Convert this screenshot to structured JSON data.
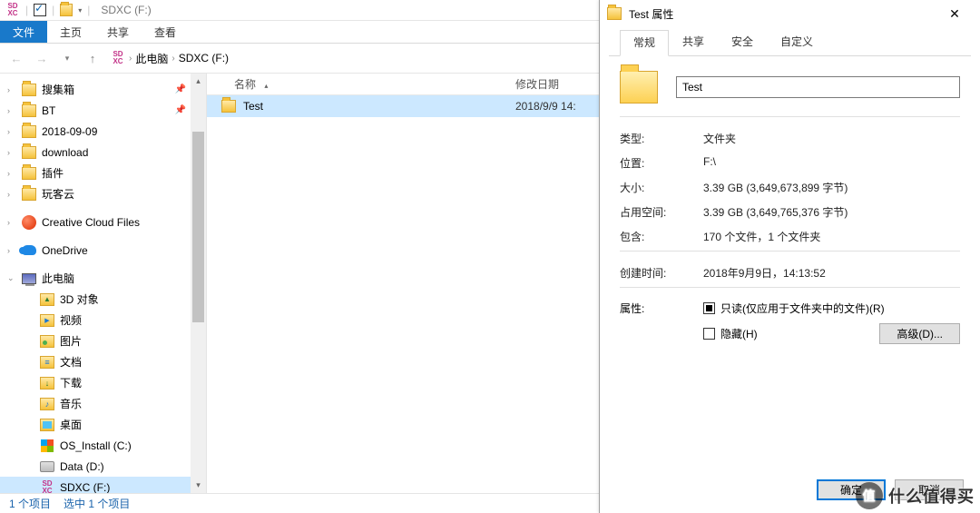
{
  "titlebar": {
    "app_icon": "SDXC",
    "window_title": "SDXC (F:)",
    "sep": "|"
  },
  "ribbon": {
    "tabs": [
      {
        "label": "文件",
        "kind": "file"
      },
      {
        "label": "主页"
      },
      {
        "label": "共享"
      },
      {
        "label": "查看"
      }
    ]
  },
  "nav": {
    "crumbs": [
      "此电脑",
      "SDXC (F:)"
    ],
    "chev": "›"
  },
  "tree": {
    "items": [
      {
        "icon": "folder",
        "label": "搜集箱",
        "pin": true
      },
      {
        "icon": "folder",
        "label": "BT",
        "pin": true
      },
      {
        "icon": "folder",
        "label": "2018-09-09"
      },
      {
        "icon": "folder",
        "label": "download"
      },
      {
        "icon": "folder",
        "label": "插件"
      },
      {
        "icon": "folder",
        "label": "玩客云"
      },
      {
        "gap": true
      },
      {
        "icon": "cc",
        "label": "Creative Cloud Files"
      },
      {
        "gap": true
      },
      {
        "icon": "od",
        "label": "OneDrive"
      },
      {
        "gap": true
      },
      {
        "icon": "pc",
        "label": "此电脑",
        "chev": "v"
      },
      {
        "icon": "3d",
        "label": "3D 对象",
        "indent": true
      },
      {
        "icon": "vid",
        "label": "视频",
        "indent": true
      },
      {
        "icon": "img",
        "label": "图片",
        "indent": true
      },
      {
        "icon": "doc",
        "label": "文档",
        "indent": true
      },
      {
        "icon": "dl",
        "label": "下载",
        "indent": true
      },
      {
        "icon": "mus",
        "label": "音乐",
        "indent": true
      },
      {
        "icon": "desk",
        "label": "桌面",
        "indent": true
      },
      {
        "icon": "win",
        "label": "OS_Install (C:)",
        "indent": true
      },
      {
        "icon": "drive",
        "label": "Data (D:)",
        "indent": true
      },
      {
        "icon": "sdxc",
        "label": "SDXC (F:)",
        "indent": true,
        "selected": true
      }
    ]
  },
  "list": {
    "columns": {
      "name": "名称",
      "date": "修改日期",
      "sort_glyph": "▴"
    },
    "rows": [
      {
        "name": "Test",
        "date": "2018/9/9 14:"
      }
    ]
  },
  "status": {
    "items": "1 个项目",
    "selection": "选中 1 个项目"
  },
  "dialog": {
    "title": "Test 属性",
    "tabs": [
      "常规",
      "共享",
      "安全",
      "自定义"
    ],
    "name_value": "Test",
    "rows": {
      "type_k": "类型:",
      "type_v": "文件夹",
      "loc_k": "位置:",
      "loc_v": "F:\\",
      "size_k": "大小:",
      "size_v": "3.39 GB (3,649,673,899 字节)",
      "disk_k": "占用空间:",
      "disk_v": "3.39 GB (3,649,765,376 字节)",
      "contains_k": "包含:",
      "contains_v": "170 个文件，1 个文件夹",
      "created_k": "创建时间:",
      "created_v": "2018年9月9日，14:13:52",
      "attr_k": "属性:",
      "readonly": "只读(仅应用于文件夹中的文件)(R)",
      "hidden": "隐藏(H)",
      "advanced": "高级(D)..."
    },
    "buttons": {
      "ok": "确定",
      "cancel": "取消"
    }
  },
  "watermark": {
    "badge": "值",
    "text": "什么值得买"
  }
}
